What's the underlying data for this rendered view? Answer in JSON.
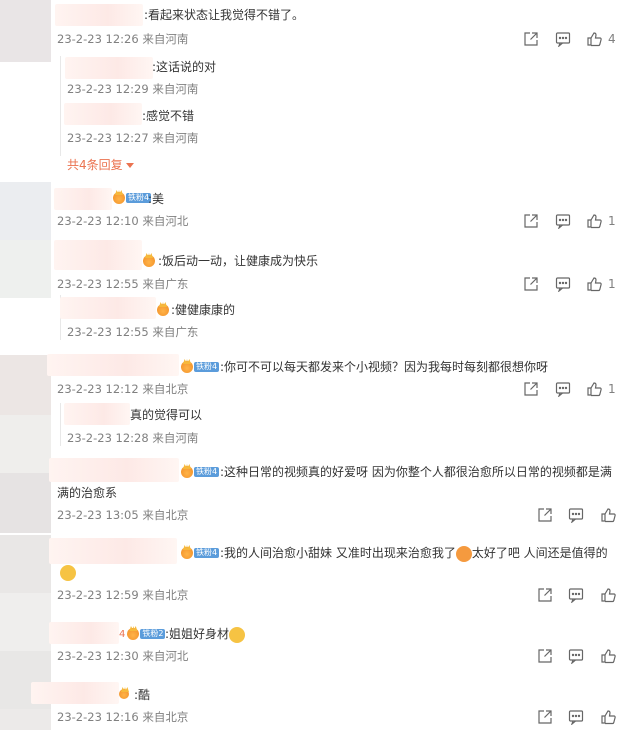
{
  "comments": [
    {
      "text": ":看起来状态让我觉得不错了。",
      "meta": "23-2-23 12:26 来自河南",
      "likes": "4",
      "replies": [
        {
          "text": ":这话说的对",
          "meta": "23-2-23 12:29 来自河南"
        },
        {
          "text": ":感觉不错",
          "meta": "23-2-23 12:27 来自河南"
        }
      ],
      "more_label": "共4条回复"
    },
    {
      "badge": "铁粉4",
      "text": ":美",
      "meta": "23-2-23 12:10 来自河北",
      "likes": "1"
    },
    {
      "text": ":饭后动一动，让健康成为快乐",
      "meta": "23-2-23 12:55 来自广东",
      "likes": "1",
      "replies": [
        {
          "text": ":健健康康的",
          "meta": "23-2-23 12:55 来自广东"
        }
      ]
    },
    {
      "badge": "铁粉4",
      "text": ":你可不可以每天都发来个小视频？因为我每时每刻都很想你呀",
      "meta": "23-2-23 12:12 来自北京",
      "likes": "1",
      "replies": [
        {
          "text": "真的觉得可以",
          "meta": "23-2-23 12:28 来自河南"
        }
      ]
    },
    {
      "badge": "铁粉4",
      "text": ":这种日常的视频真的好爱呀 因为你整个人都很治愈所以日常的视频都是满",
      "text2": "满的治愈系",
      "meta": "23-2-23 13:05 来自北京"
    },
    {
      "badge": "铁粉4",
      "text": ":我的人间治愈小甜妹 又准时出现来治愈我了",
      "text_after": "太好了吧 人间还是值得的",
      "meta": "23-2-23 12:59 来自北京"
    },
    {
      "badge_prefix": "4",
      "badge": "铁粉2",
      "text": ":姐姐好身材",
      "meta": "23-2-23 12:30 来自河北"
    },
    {
      "text": ":酷",
      "meta": "23-2-23 12:16 来自北京"
    }
  ],
  "icons": {
    "forward": "forward-icon",
    "comment": "comment-icon",
    "like": "like-icon"
  }
}
